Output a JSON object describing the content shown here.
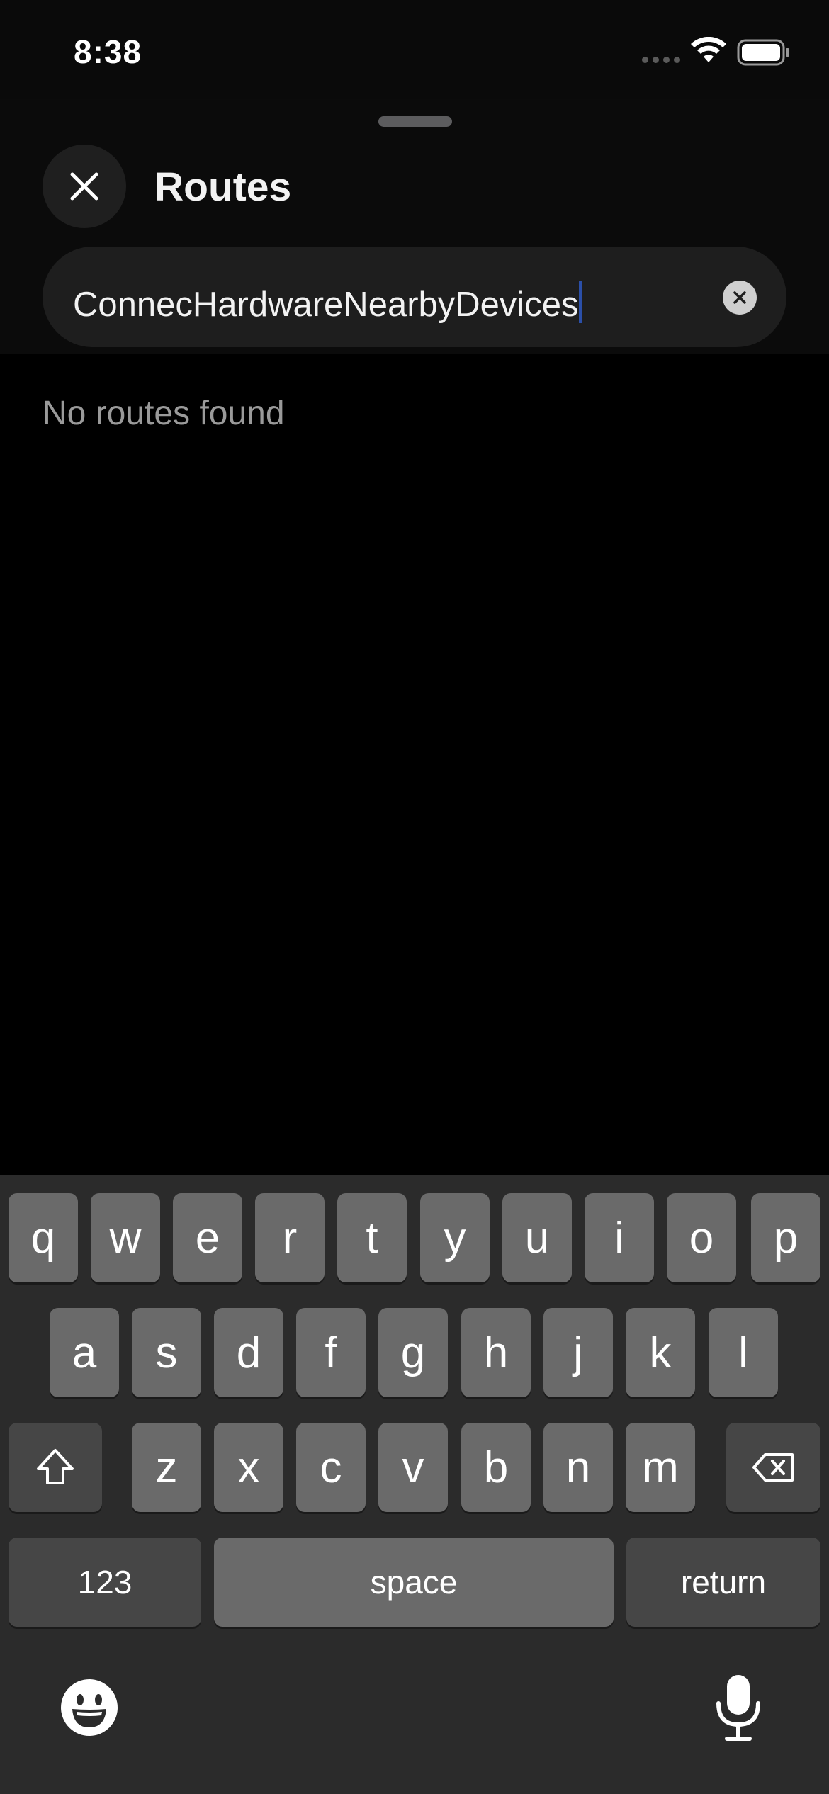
{
  "status_bar": {
    "time": "8:38",
    "wifi_icon": "wifi-icon",
    "battery_icon": "battery-icon"
  },
  "sheet": {
    "title": "Routes",
    "close_icon": "close-icon",
    "search": {
      "value": "ConnecHardwareNearbyDevices",
      "clear_icon": "clear-icon"
    },
    "empty_message": "No routes found"
  },
  "keyboard": {
    "row1": [
      "q",
      "w",
      "e",
      "r",
      "t",
      "y",
      "u",
      "i",
      "o",
      "p"
    ],
    "row2": [
      "a",
      "s",
      "d",
      "f",
      "g",
      "h",
      "j",
      "k",
      "l"
    ],
    "row3": [
      "z",
      "x",
      "c",
      "v",
      "b",
      "n",
      "m"
    ],
    "shift_icon": "shift-icon",
    "delete_icon": "delete-icon",
    "numbers_label": "123",
    "space_label": "space",
    "return_label": "return",
    "emoji_icon": "emoji-icon",
    "mic_icon": "microphone-icon"
  },
  "colors": {
    "background": "#000000",
    "keyboard_background": "#2b2b2b",
    "key": "#6a6a6a",
    "special_key": "#464646",
    "caret": "#2b4fa8"
  }
}
